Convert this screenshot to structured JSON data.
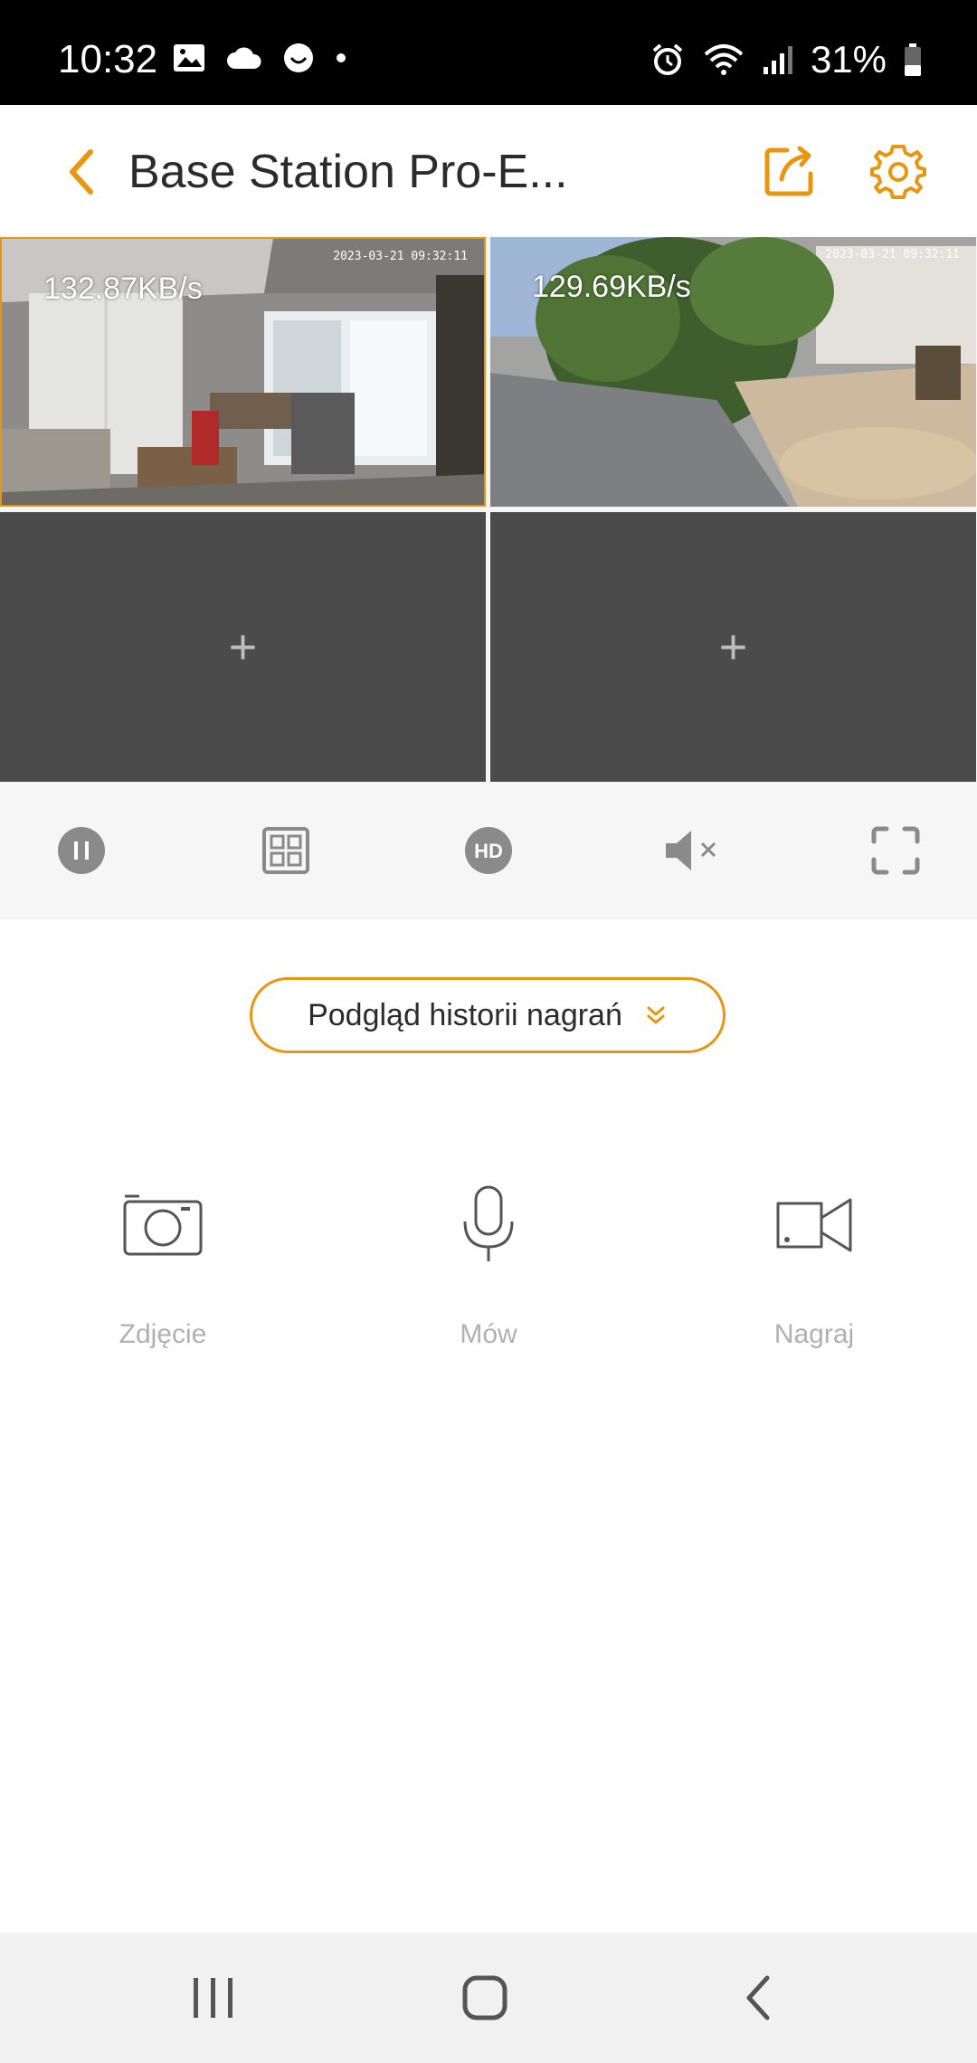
{
  "status_bar": {
    "time": "10:32",
    "battery": "31%",
    "left_icons": [
      "image-icon",
      "cloud-icon",
      "face-icon",
      "dot-icon"
    ],
    "right_icons": [
      "alarm-icon",
      "wifi-icon",
      "signal-icon",
      "battery-icon"
    ]
  },
  "app_bar": {
    "title": "Base Station Pro-E...",
    "accent_color": "#e8950f"
  },
  "cameras": [
    {
      "bitrate": "132.87KB/s",
      "timestamp": "2023-03-21 09:32:11"
    },
    {
      "bitrate": "129.69KB/s",
      "timestamp": "2023-03-21 09:32:11"
    },
    {
      "add_symbol": "+"
    },
    {
      "add_symbol": "+"
    }
  ],
  "controls": [
    "pause-icon",
    "grid-layout-icon",
    "hd-icon",
    "mute-icon",
    "fullscreen-icon"
  ],
  "hd_label": "HD",
  "history_button": {
    "label": "Podgląd historii nagrań"
  },
  "actions": [
    {
      "label": "Zdjęcie",
      "icon": "camera-icon"
    },
    {
      "label": "Mów",
      "icon": "microphone-icon"
    },
    {
      "label": "Nagraj",
      "icon": "video-record-icon"
    }
  ],
  "nav_bar": [
    "recent-apps-icon",
    "home-icon",
    "back-icon"
  ]
}
